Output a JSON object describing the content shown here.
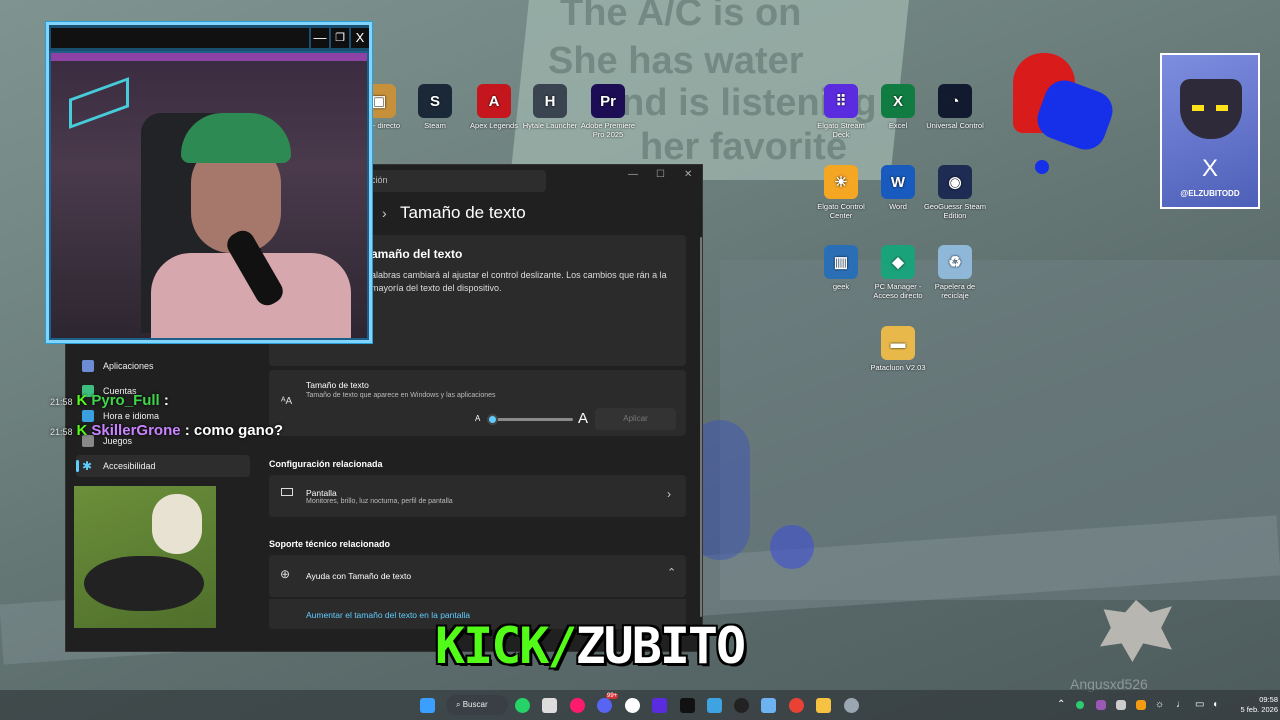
{
  "wallpaper": {
    "ghost_lines": [
      "The A/C is on",
      "She has water",
      "and is listening",
      "her favorite"
    ]
  },
  "desktop_icons": [
    {
      "label": "Steam",
      "glyph": "S",
      "color": "#1b2838"
    },
    {
      "label": "Apex Legends",
      "glyph": "A",
      "color": "#c4161c"
    },
    {
      "label": "Hytale Launcher",
      "glyph": "H",
      "color": "#3a4350"
    },
    {
      "label": "Adobe Premiere Pro 2025",
      "glyph": "Pr",
      "color": "#1c0d55"
    },
    {
      "label": "Elgato Stream Deck",
      "glyph": "⠿",
      "color": "#5b2be0"
    },
    {
      "label": "Excel",
      "glyph": "X",
      "color": "#107c41"
    },
    {
      "label": "Universal Control",
      "glyph": "◔",
      "color": "#111a2e"
    },
    {
      "label": "Elgato Control Center",
      "glyph": "☀",
      "color": "#f5a623"
    },
    {
      "label": "Word",
      "glyph": "W",
      "color": "#185abd"
    },
    {
      "label": "GeoGuessr Steam Edition",
      "glyph": "◉",
      "color": "#1e2b52"
    },
    {
      "label": "geek",
      "glyph": "▥",
      "color": "#2a6fb5"
    },
    {
      "label": "PC Manager - Acceso directo",
      "glyph": "◆",
      "color": "#1aa37a"
    },
    {
      "label": "Papelera de reciclaje",
      "glyph": "♻",
      "color": "#8fb7d8"
    },
    {
      "label": "Patacluon V2.03",
      "glyph": "▬",
      "color": "#e8b84a"
    },
    {
      "label": "mgr - directo",
      "glyph": "▣",
      "color": "#c7903a"
    }
  ],
  "settings": {
    "search_placeholder": "ción",
    "breadcrumb": "Tamaño de texto",
    "header_title": "amaño del texto",
    "header_desc": "alabras cambiará al ajustar el control deslizante. Los cambios que rán a la mayoría del texto del dispositivo.",
    "nav": [
      "Aplicaciones",
      "Cuentas",
      "Hora e idioma",
      "Juegos",
      "Accesibilidad"
    ],
    "text_size_title": "Tamaño de texto",
    "text_size_desc": "Tamaño de texto que aparece en Windows y las aplicaciones",
    "slider_small": "A",
    "slider_large": "A",
    "slider_value": 0.0,
    "apply_label": "Aplicar",
    "related_title": "Configuración relacionada",
    "display_title": "Pantalla",
    "display_desc": "Monitores, brillo, luz nocturna, perfil de pantalla",
    "support_title": "Soporte técnico relacionado",
    "help_title": "Ayuda con Tamaño de texto",
    "help_link": "Aumentar el tamaño del texto en la pantalla"
  },
  "cam_window": {
    "minimize": "—",
    "restore": "❐",
    "close": "X"
  },
  "chat": [
    {
      "time": "21:58",
      "user": "Pyro_Full",
      "message": ":"
    },
    {
      "time": "21:58",
      "user": "SkillerGrone",
      "message": ": como gano?"
    }
  ],
  "overlay": {
    "kick": "KICK/",
    "name": "ZUBITO",
    "watermark": "Angusxd526",
    "badge": "@ELZUBITODD",
    "badge_glyph": "X"
  },
  "taskbar": {
    "search_label": "Buscar",
    "discord_badge": "99+",
    "time": "09:58",
    "date": "5 feb. 2026"
  },
  "colors": {
    "kick_green": "#53fc18",
    "accent": "#60cdff"
  }
}
